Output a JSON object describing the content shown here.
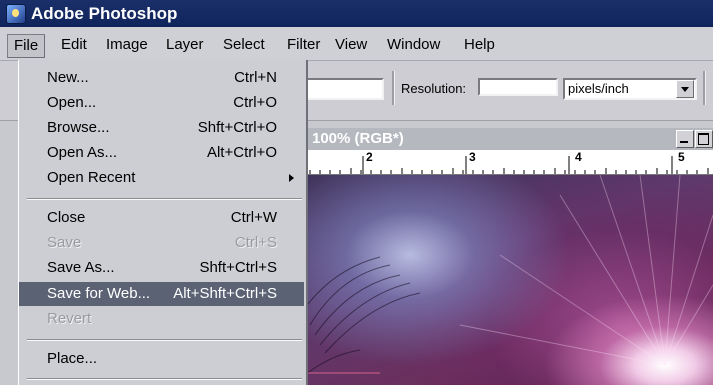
{
  "titlebar": {
    "title": "Adobe Photoshop"
  },
  "menubar": {
    "items": [
      {
        "label": "File",
        "key": "F"
      },
      {
        "label": "Edit"
      },
      {
        "label": "Image"
      },
      {
        "label": "Layer"
      },
      {
        "label": "Select"
      },
      {
        "label": "Filter"
      },
      {
        "label": "View"
      },
      {
        "label": "Window"
      },
      {
        "label": "Help"
      }
    ]
  },
  "options": {
    "resolution_label": "Resolution:",
    "resolution_value": "",
    "unit_value": "pixels/inch"
  },
  "document": {
    "title": "100% (RGB*)",
    "ruler_numbers": [
      "2",
      "3",
      "4",
      "5"
    ]
  },
  "file_menu": {
    "items": [
      {
        "label": "New...",
        "shortcut": "Ctrl+N",
        "state": "normal"
      },
      {
        "label": "Open...",
        "shortcut": "Ctrl+O",
        "state": "normal"
      },
      {
        "label": "Browse...",
        "shortcut": "Shft+Ctrl+O",
        "state": "normal"
      },
      {
        "label": "Open As...",
        "shortcut": "Alt+Ctrl+O",
        "state": "normal"
      },
      {
        "label": "Open Recent",
        "shortcut": "",
        "state": "submenu"
      },
      {
        "label": "Close",
        "shortcut": "Ctrl+W",
        "state": "normal"
      },
      {
        "label": "Save",
        "shortcut": "Ctrl+S",
        "state": "disabled"
      },
      {
        "label": "Save As...",
        "shortcut": "Shft+Ctrl+S",
        "state": "normal"
      },
      {
        "label": "Save for Web...",
        "shortcut": "Alt+Shft+Ctrl+S",
        "state": "highlighted"
      },
      {
        "label": "Revert",
        "shortcut": "",
        "state": "disabled"
      },
      {
        "label": "Place...",
        "shortcut": "",
        "state": "normal"
      }
    ]
  },
  "colors": {
    "titlebar": "#10245c",
    "menu_highlight": "#5a6274",
    "menu_bg": "#cdced4"
  }
}
